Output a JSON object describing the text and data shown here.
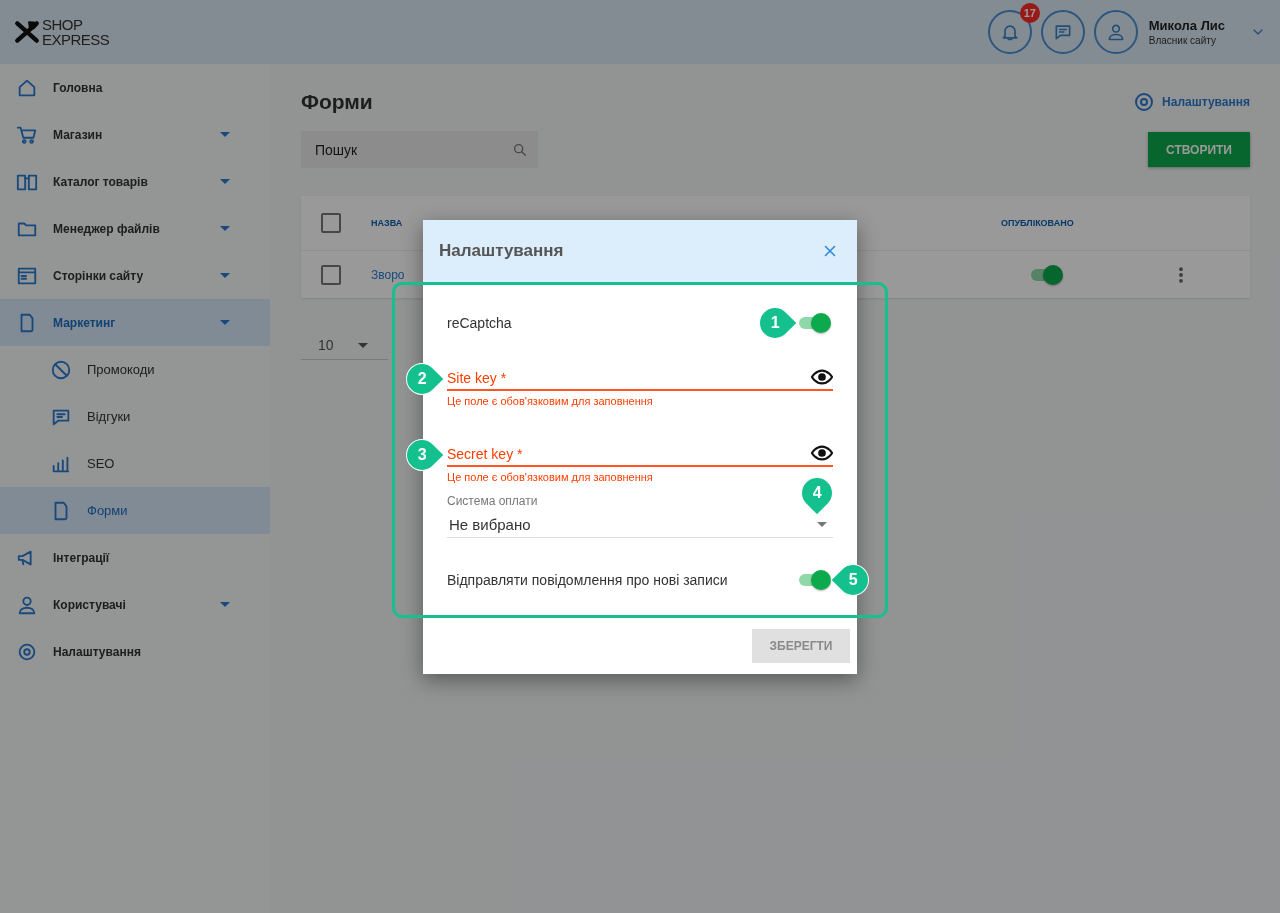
{
  "topbar": {
    "logo": [
      "SHOP",
      "EXPRESS"
    ],
    "notifications": {
      "count": "17"
    },
    "user": {
      "name": "Микола Лис",
      "role": "Власник сайту"
    }
  },
  "sidebar": {
    "items": [
      {
        "label": "Головна",
        "selected": false,
        "has_submenu": false
      },
      {
        "label": "Магазин",
        "selected": false,
        "has_submenu": true
      },
      {
        "label": "Каталог товарів",
        "selected": false,
        "has_submenu": true
      },
      {
        "label": "Менеджер файлів",
        "selected": false,
        "has_submenu": true
      },
      {
        "label": "Сторінки сайту",
        "selected": false,
        "has_submenu": true
      },
      {
        "label": "Маркетинг",
        "selected": true,
        "has_submenu": true,
        "expanded": true,
        "children": [
          {
            "label": "Промокоди",
            "selected": false
          },
          {
            "label": "Відгуки",
            "selected": false
          },
          {
            "label": "SEO",
            "selected": false
          },
          {
            "label": "Форми",
            "selected": true
          }
        ]
      },
      {
        "label": "Інтеграції",
        "selected": false,
        "has_submenu": false
      },
      {
        "label": "Користувачі",
        "selected": false,
        "has_submenu": true
      },
      {
        "label": "Налаштування",
        "selected": false,
        "has_submenu": false
      }
    ]
  },
  "page": {
    "title": "Форми",
    "settings_link": "Налаштування",
    "search": {
      "placeholder": "Пошук"
    },
    "create_button": "СТВОРИТИ",
    "table": {
      "columns": [
        "НАЗВА",
        "ОПУБЛІКОВАНО"
      ],
      "header_checked": false,
      "rows": [
        {
          "checked": false,
          "name": "Зворо",
          "published": true
        }
      ]
    },
    "page_size": "10"
  },
  "dialog": {
    "title": "Налаштування",
    "highlighted": true,
    "items": [
      {
        "kind": "toggle",
        "label": "reCaptcha",
        "on": true,
        "callout": "1"
      },
      {
        "kind": "password",
        "label": "Site key *",
        "invalid": true,
        "error": "Це поле є обов'язковим для заповнення",
        "callout": "2"
      },
      {
        "kind": "password",
        "label": "Secret key *",
        "invalid": true,
        "error": "Це поле є обов'язковим для заповнення",
        "callout": "3"
      },
      {
        "kind": "select",
        "label": "Система оплати",
        "value": "Не вибрано",
        "callout": "4"
      },
      {
        "kind": "toggle",
        "label": "Відправляти повідомлення про нові записи",
        "on": true,
        "callout": "5"
      }
    ],
    "save_button": {
      "label": "ЗБЕРЕГТИ",
      "disabled": true
    }
  }
}
